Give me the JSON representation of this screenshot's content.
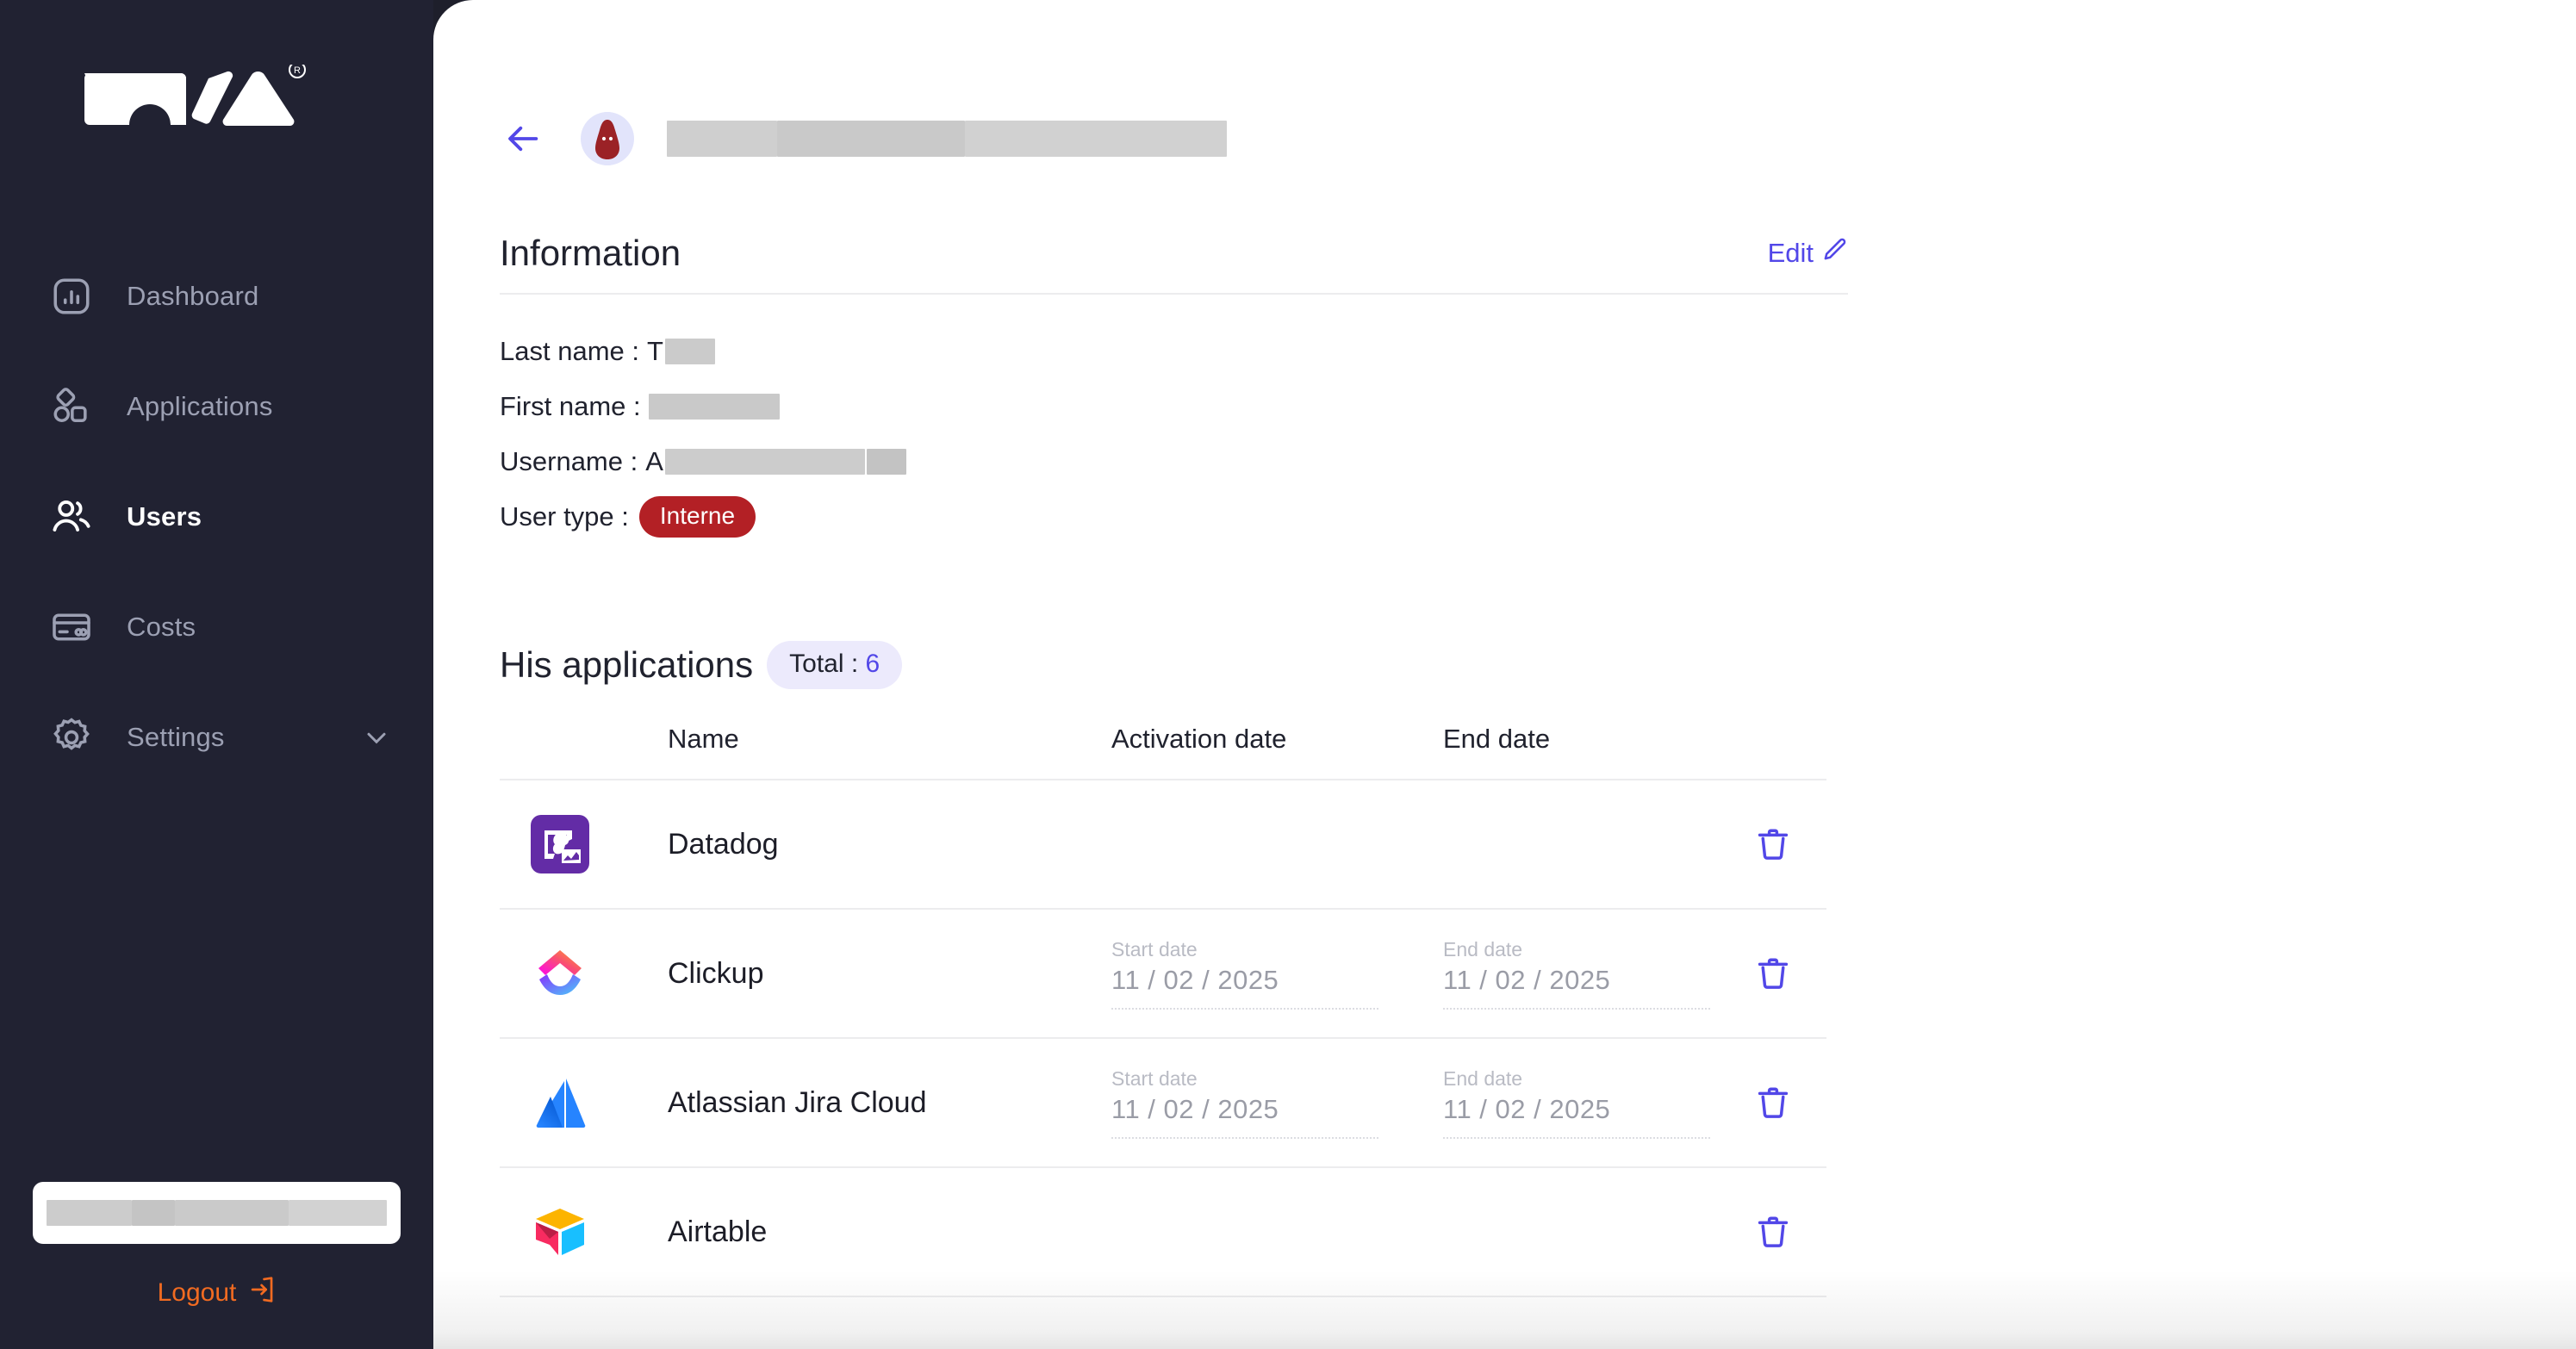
{
  "brand": {
    "logo_name": "brand-logo",
    "trademark": "®"
  },
  "colors": {
    "sidebar_bg": "#212232",
    "accent_purple": "#5247e8",
    "logout_orange": "#f26b21",
    "badge_red": "#b32025",
    "pill_lavender": "#eceafc"
  },
  "sidebar": {
    "items": [
      {
        "label": "Dashboard",
        "icon": "chart-bar-icon",
        "active": false
      },
      {
        "label": "Applications",
        "icon": "shapes-icon",
        "active": false
      },
      {
        "label": "Users",
        "icon": "users-icon",
        "active": true
      },
      {
        "label": "Costs",
        "icon": "credit-card-icon",
        "active": false
      },
      {
        "label": "Settings",
        "icon": "gear-icon",
        "active": false,
        "has_chevron": true
      }
    ],
    "logout_label": "Logout",
    "logout_icon": "logout-icon",
    "user_card_redacted": true
  },
  "header": {
    "back_icon": "back-arrow-icon",
    "avatar_icon": "user-avatar-ghost-icon",
    "title_redacted": true
  },
  "information": {
    "title": "Information",
    "edit_label": "Edit",
    "edit_icon": "pencil-icon",
    "fields": [
      {
        "label": "Last name :",
        "value_prefix": "T",
        "redacted": true
      },
      {
        "label": "First name :",
        "value_prefix": "",
        "redacted": true
      },
      {
        "label": "Username :",
        "value_prefix": "A",
        "redacted": true
      }
    ],
    "user_type_label": "User type :",
    "user_type_value": "Interne"
  },
  "applications": {
    "title": "His applications",
    "total_label": "Total :",
    "total_value": "6",
    "columns": [
      "",
      "Name",
      "Activation date",
      "End date",
      ""
    ],
    "start_date_label": "Start date",
    "end_date_label": "End date",
    "delete_icon": "trash-icon",
    "rows": [
      {
        "name": "Datadog",
        "logo": "datadog-logo",
        "has_dates": false,
        "start_date": "",
        "end_date": ""
      },
      {
        "name": "Clickup",
        "logo": "clickup-logo",
        "has_dates": true,
        "start_date": "11 / 02 / 2025",
        "end_date": "11 / 02 / 2025",
        "start_parts": [
          "11",
          "02",
          "2025"
        ],
        "end_parts": [
          "11",
          "02",
          "2025"
        ]
      },
      {
        "name": "Atlassian Jira Cloud",
        "logo": "atlassian-logo",
        "has_dates": true,
        "start_date": "11 / 02 / 2025",
        "end_date": "11 / 02 / 2025",
        "start_parts": [
          "11",
          "02",
          "2025"
        ],
        "end_parts": [
          "11",
          "02",
          "2025"
        ]
      },
      {
        "name": "Airtable",
        "logo": "airtable-logo",
        "has_dates": false,
        "start_date": "",
        "end_date": ""
      }
    ]
  }
}
